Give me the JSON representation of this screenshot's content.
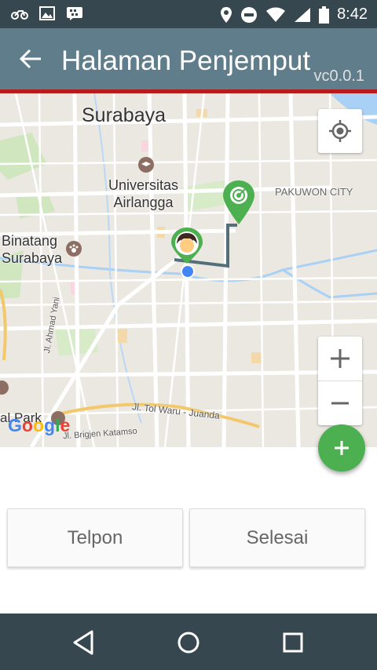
{
  "status_bar": {
    "time": "8:42",
    "left_icons": [
      "motorbike-icon",
      "image-icon",
      "bbm-icon"
    ],
    "right_icons": [
      "location-icon",
      "do-not-disturb-icon",
      "wifi-icon",
      "signal-icon",
      "battery-icon"
    ]
  },
  "app_bar": {
    "title": "Halaman Penjemput",
    "version": "vc0.0.1",
    "back_icon": "arrow-back-icon",
    "color": "#607d8b"
  },
  "map": {
    "labels": {
      "city": "Surabaya",
      "university_line1": "Universitas",
      "university_line2": "Airlangga",
      "pakuwon": "PAKUWON CITY",
      "zoo_line1": "Binatang",
      "zoo_line2": "Surabaya",
      "street_yani": "Jl. Ahmad Yani",
      "park": "al Park",
      "toll_road": "Jl. Tol Waru - Juanda",
      "street_brigjen": "Jl. Brigjen Katamso"
    },
    "logo": {
      "letters": [
        "G",
        "o",
        "o",
        "g",
        "l",
        "e"
      ],
      "colors": [
        "#4285f4",
        "#ea4335",
        "#fbbc05",
        "#4285f4",
        "#34a853",
        "#ea4335"
      ]
    },
    "markers": [
      "driver-marker-icon",
      "destination-marker-icon",
      "current-location-dot"
    ],
    "route_color": "#546e7a",
    "marker_color": "#4caf50"
  },
  "controls": {
    "my_location": "my-location-icon",
    "zoom_in": "+",
    "zoom_out": "−",
    "fab": "+"
  },
  "buttons": {
    "call": "Telpon",
    "finish": "Selesai"
  },
  "nav_bar": [
    "back-triangle-icon",
    "home-circle-icon",
    "recents-square-icon"
  ]
}
